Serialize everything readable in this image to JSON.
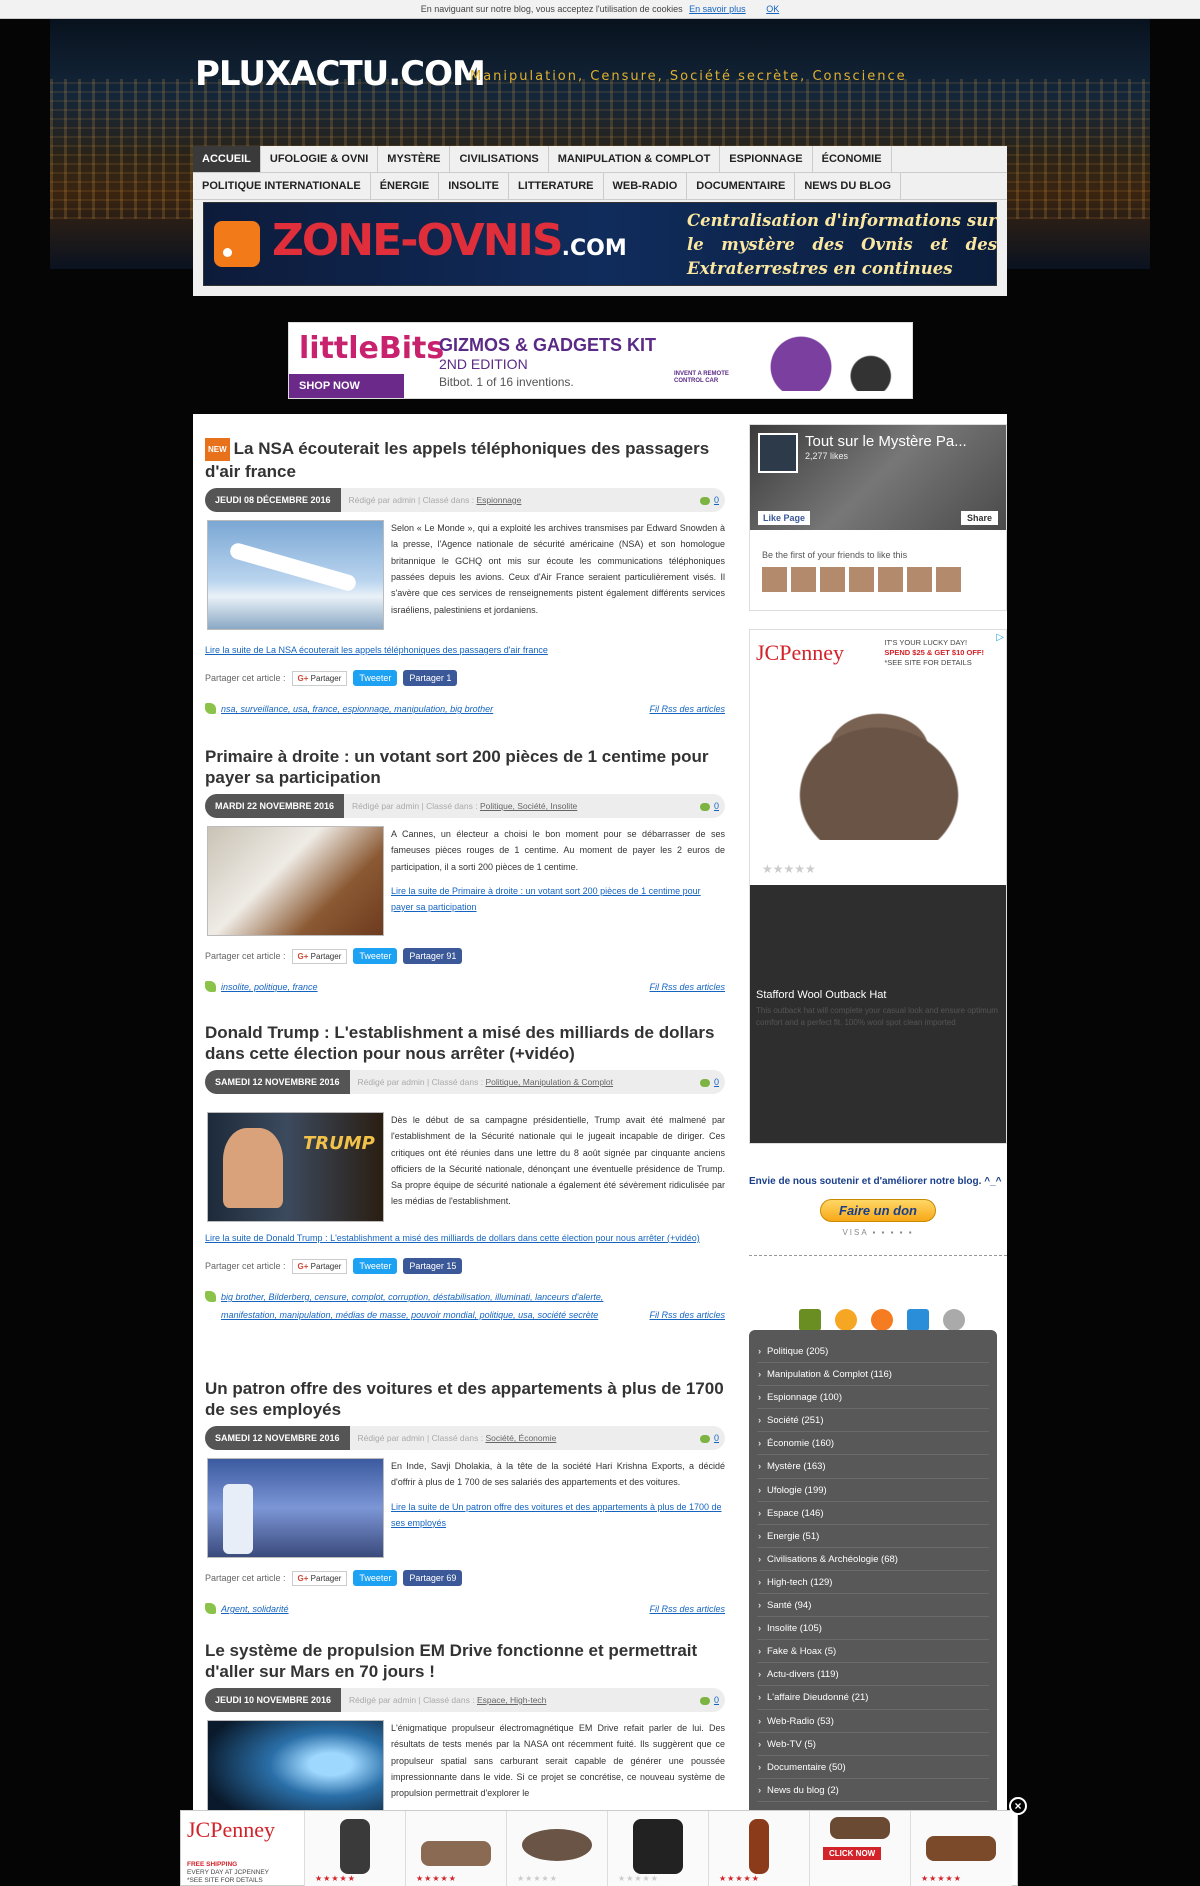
{
  "cookie": {
    "text": "En naviguant sur notre blog, vous acceptez l'utilisation de cookies",
    "more": "En savoir plus",
    "ok": "OK"
  },
  "site": {
    "name": "PLUXACTU.COM",
    "tagline": "Manipulation, Censure, Société secrète, Conscience"
  },
  "nav": {
    "row1": [
      "ACCUEIL",
      "UFOLOGIE & OVNI",
      "MYSTÈRE",
      "CIVILISATIONS",
      "MANIPULATION & COMPLOT",
      "ESPIONNAGE",
      "ÉCONOMIE"
    ],
    "row2": [
      "POLITIQUE INTERNATIONALE",
      "ÉNERGIE",
      "INSOLITE",
      "LITTERATURE",
      "WEB-RADIO",
      "DOCUMENTAIRE",
      "NEWS DU BLOG"
    ]
  },
  "zone": {
    "title": "ZONE-OVNIS",
    "com": ".COM",
    "right": "Centralisation d'informations sur le mystère des Ovnis et des Extraterrestres en continues"
  },
  "banner": {
    "brand": "littleBits",
    "shop": "SHOP NOW",
    "title": "GIZMOS & GADGETS KIT",
    "edition": "2ND EDITION",
    "sub": "Bitbot. 1 of 16 inventions.",
    "badge": "INVENT A REMOTE CONTROL CAR"
  },
  "posts": [
    {
      "new": "NEW",
      "title": "La NSA écouterait les appels téléphoniques des passagers d'air france",
      "date": "JEUDI 08 DÉCEMBRE 2016",
      "author": "Rédigé par admin | Classé dans :",
      "cats": "Espionnage",
      "comments": "0",
      "text": "Selon « Le Monde », qui a exploité les archives transmises par Edward Snowden à la presse, l'Agence nationale de sécurité américaine (NSA) et son homologue britannique le GCHQ ont mis sur écoute les communications téléphoniques passées depuis les avions. Ceux d'Air France seraient particulièrement visés. Il s'avère que ces services de renseignements pistent également différents services israéliens, palestiniens et jordaniens.",
      "readmore": "Lire la suite de La NSA écouterait les appels téléphoniques des passagers d'air france",
      "share": "Partager cet article :",
      "gplus": "Partager",
      "tweet": "Tweeter",
      "fb": "Partager 1",
      "tags": "nsa, surveillance, usa, france, espionnage, manipulation, big brother",
      "rss": "Fil Rss des articles"
    },
    {
      "title": "Primaire à droite : un votant sort 200 pièces de 1 centime pour payer sa participation",
      "date": "MARDI 22 NOVEMBRE 2016",
      "author": "Rédigé par admin | Classé dans :",
      "cats": "Politique, Société, Insolite",
      "comments": "0",
      "text": "A Cannes, un électeur a choisi le bon moment pour se débarrasser de ses fameuses pièces rouges de 1 centime. Au moment de payer les 2 euros de participation, il a sorti 200 pièces de 1 centime.",
      "readmore": "Lire la suite de Primaire à droite : un votant sort 200 pièces de 1 centime pour payer sa participation",
      "share": "Partager cet article :",
      "gplus": "Partager",
      "tweet": "Tweeter",
      "fb": "Partager 91",
      "tags": "insolite, politique, france",
      "rss": "Fil Rss des articles"
    },
    {
      "title": "Donald Trump : L'establishment a misé des milliards de dollars dans cette élection pour nous arrêter (+vidéo)",
      "date": "SAMEDI 12 NOVEMBRE 2016",
      "author": "Rédigé par admin | Classé dans :",
      "cats": "Politique, Manipulation & Complot",
      "comments": "0",
      "text": "Dès le début de sa campagne présidentielle, Trump avait été malmené par l'establishment de la Sécurité nationale qui le jugeait incapable de diriger. Ces critiques ont été réunies dans une lettre du 8 août signée par cinquante anciens officiers de la Sécurité nationale, dénonçant une éventuelle présidence de Trump. Sa propre équipe de sécurité nationale a également été sévèrement ridiculisée par les médias de l'establishment.",
      "readmore": "Lire la suite de Donald Trump : L'establishment a misé des milliards de dollars dans cette élection pour nous arrêter (+vidéo)",
      "share": "Partager cet article :",
      "gplus": "Partager",
      "tweet": "Tweeter",
      "fb": "Partager 15",
      "tags": "big brother, Bilderberg, censure, complot, corruption, déstabilisation, illuminati, lanceurs d'alerte, manifestation, manipulation, médias de masse, pouvoir mondial, politique, usa, société secrète",
      "rss": "Fil Rss des articles"
    },
    {
      "title": "Un patron offre des voitures et des appartements à plus de 1700 de ses employés",
      "date": "SAMEDI 12 NOVEMBRE 2016",
      "author": "Rédigé par admin | Classé dans :",
      "cats": "Société, Économie",
      "comments": "0",
      "text": "En Inde, Savji Dholakia, à la tête de la société Hari Krishna Exports, a décidé d'offrir à plus de 1 700 de ses salariés des appartements et des voitures.",
      "readmore": "Lire la suite de Un patron offre des voitures et des appartements à plus de 1700 de ses employés",
      "share": "Partager cet article :",
      "gplus": "Partager",
      "tweet": "Tweeter",
      "fb": "Partager 69",
      "tags": "Argent, solidarité",
      "rss": "Fil Rss des articles"
    },
    {
      "title": "Le système de propulsion EM Drive fonctionne et permettrait d'aller sur Mars en 70 jours !",
      "date": "JEUDI 10 NOVEMBRE 2016",
      "author": "Rédigé par admin | Classé dans :",
      "cats": "Espace, High-tech",
      "comments": "0",
      "text": "L'énigmatique propulseur électromagnétique EM Drive refait parler de lui. Des résultats de tests menés par la NASA ont récemment fuité. Ils suggèrent que ce propulseur spatial sans carburant serait capable de générer une poussée impressionnante dans le vide. Si ce projet se concrétise, ce nouveau système de propulsion permettrait d'explorer le"
    }
  ],
  "sidebar": {
    "fb": {
      "title": "Tout sur le Mystère Pa...",
      "likes": "2,277 likes",
      "like": "Like Page",
      "share": "Share",
      "first": "Be the first of your friends to like this"
    },
    "jcp": {
      "brand": "JCPenney",
      "lucky1": "IT'S YOUR LUCKY DAY!",
      "lucky2": "SPEND $25 & GET $10 OFF!",
      "lucky3": "*SEE SITE FOR DETAILS",
      "stars": "★★★★★",
      "name": "Stafford Wool Outback Hat",
      "desc": "This outback hat will complete your casual look and ensure optimum comfort and a perfect fit. 100% wool spot clean imported"
    },
    "donate": {
      "text": "Envie de nous soutenir et d'améliorer notre blog. ^_^",
      "button": "Faire un don",
      "cards": "VISA ▪ ▪ ▪ ▪ ▪"
    },
    "categories": [
      "Politique (205)",
      "Manipulation & Complot (116)",
      "Espionnage (100)",
      "Société (251)",
      "Économie (160)",
      "Mystère (163)",
      "Ufologie (199)",
      "Espace (146)",
      "Energie (51)",
      "Civilisations & Archéologie (68)",
      "High-tech (129)",
      "Santé (94)",
      "Insolite (105)",
      "Fake & Hoax (5)",
      "Actu-divers (119)",
      "L'affaire Dieudonné (21)",
      "Web-Radio (53)",
      "Web-TV (5)",
      "Documentaire (50)",
      "News du blog (2)"
    ]
  },
  "bottomad": {
    "brand": "JCPenney",
    "free": "FREE SHIPPING",
    "every": "EVERY DAY AT JCPENNEY",
    "see": "*SEE SITE FOR DETAILS",
    "click": "CLICK NOW",
    "stars": "★★★★★"
  }
}
